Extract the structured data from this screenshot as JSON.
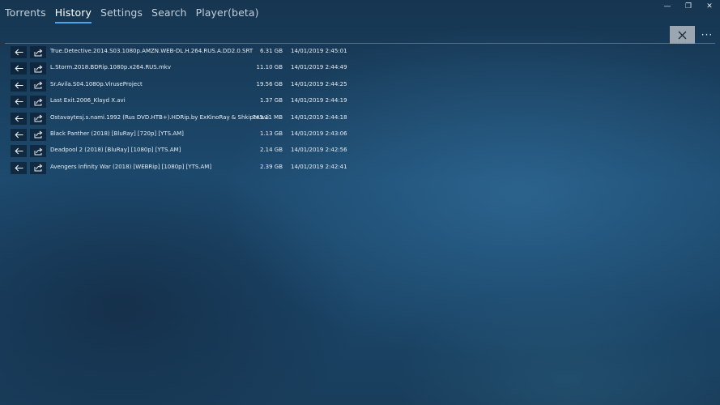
{
  "nav": {
    "tabs": [
      {
        "label": "Torrents",
        "active": false
      },
      {
        "label": "History",
        "active": true
      },
      {
        "label": "Settings",
        "active": false
      },
      {
        "label": "Search",
        "active": false
      },
      {
        "label": "Player(beta)",
        "active": false
      }
    ]
  },
  "window_controls": {
    "minimize": "—",
    "maximize": "❐",
    "close": "✕"
  },
  "toolbar": {
    "close_icon": "close-icon",
    "more_label": "···"
  },
  "colors": {
    "accent": "#4aa6e8",
    "close_button_bg": "#9aa6b1",
    "row_button_bg": "#0c2034"
  },
  "history": [
    {
      "name": "True.Detective.2014.S03.1080p.AMZN.WEB-DL.H.264.RUS.A.DD2.0.SRT",
      "size": "6.31 GB",
      "date": "14/01/2019 2:45:01"
    },
    {
      "name": "L.Storm.2018.BDRip.1080p.x264.RUS.mkv",
      "size": "11.10 GB",
      "date": "14/01/2019 2:44:49"
    },
    {
      "name": "Sr.Avila.S04.1080p.ViruseProject",
      "size": "19.56 GB",
      "date": "14/01/2019 2:44:25"
    },
    {
      "name": "Last Exit.2006_Klayd X.avi",
      "size": "1.37 GB",
      "date": "14/01/2019 2:44:19"
    },
    {
      "name": "Ostavaytesj.s.nami.1992 (Rus DVD.HTB+).HDRip.by ExKinoRay & Shkiper.avi",
      "size": "745.11 MB",
      "date": "14/01/2019 2:44:18"
    },
    {
      "name": "Black Panther (2018) [BluRay] [720p] [YTS.AM]",
      "size": "1.13 GB",
      "date": "14/01/2019 2:43:06"
    },
    {
      "name": "Deadpool 2 (2018) [BluRay] [1080p] [YTS.AM]",
      "size": "2.14 GB",
      "date": "14/01/2019 2:42:56"
    },
    {
      "name": "Avengers Infinity War (2018) [WEBRip] [1080p] [YTS.AM]",
      "size": "2.39 GB",
      "date": "14/01/2019 2:42:41"
    }
  ]
}
